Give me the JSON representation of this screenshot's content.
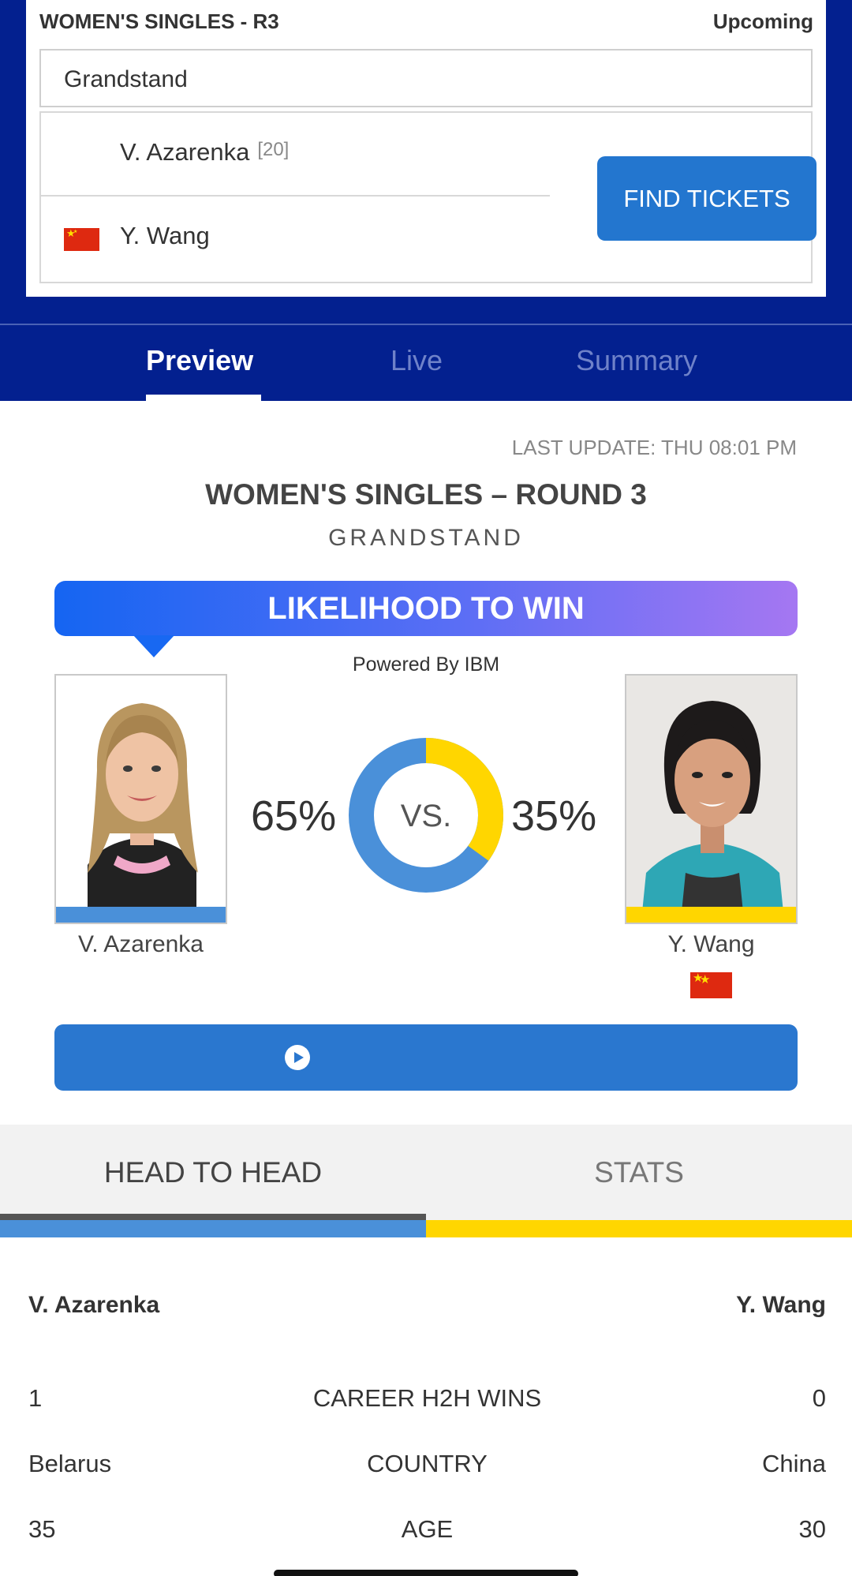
{
  "match_card": {
    "title": "WOMEN'S SINGLES - R3",
    "status": "Upcoming",
    "court": "Grandstand",
    "player1": {
      "name": "V. Azarenka",
      "seed": "[20]"
    },
    "player2": {
      "name": "Y. Wang",
      "flag": "china-flag"
    },
    "find_tickets_label": "FIND TICKETS"
  },
  "tabs": [
    {
      "label": "Preview",
      "active": true
    },
    {
      "label": "Live",
      "active": false
    },
    {
      "label": "Summary",
      "active": false
    }
  ],
  "preview": {
    "last_update": "LAST UPDATE: THU 08:01 PM",
    "round_title": "WOMEN'S SINGLES – ROUND 3",
    "court": "GRANDSTAND",
    "likelihood_title": "LIKELIHOOD TO WIN",
    "powered_by": "Powered By IBM",
    "player1": {
      "name": "V. Azarenka",
      "percent": "65%",
      "color": "#4a90d9"
    },
    "player2": {
      "name": "Y. Wang",
      "percent": "35%",
      "color": "#ffd600",
      "flag": "china-flag"
    },
    "vs_label": "VS.",
    "win_probability": {
      "player1": 0.65,
      "player2": 0.35
    }
  },
  "h2h": {
    "tabs": [
      "HEAD TO HEAD",
      "STATS"
    ],
    "player1": "V. Azarenka",
    "player2": "Y. Wang",
    "rows": [
      {
        "left": "1",
        "label": "CAREER H2H WINS",
        "right": "0"
      },
      {
        "left": "Belarus",
        "label": "COUNTRY",
        "right": "China"
      },
      {
        "left": "35",
        "label": "AGE",
        "right": "30"
      }
    ]
  },
  "colors": {
    "navy": "#03208f",
    "button_blue": "#2376cf",
    "player1_blue": "#4a90d9",
    "player2_yellow": "#ffd600"
  }
}
